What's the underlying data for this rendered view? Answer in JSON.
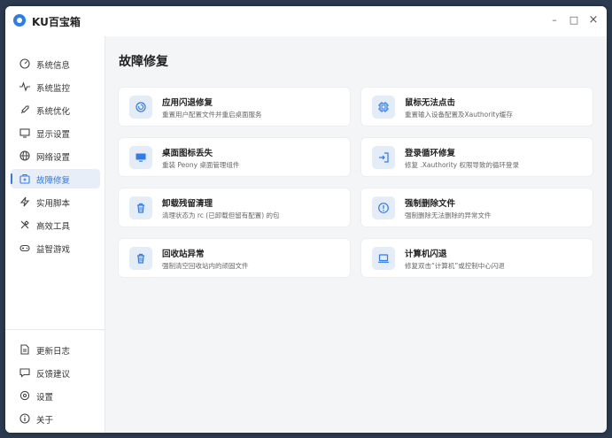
{
  "app": {
    "title": "KU百宝箱"
  },
  "window_controls": {
    "minimize": "–",
    "maximize": "□",
    "close": "×"
  },
  "sidebar": {
    "items": [
      {
        "label": "系统信息",
        "icon": "gauge-icon"
      },
      {
        "label": "系统监控",
        "icon": "pulse-icon"
      },
      {
        "label": "系统优化",
        "icon": "rocket-icon"
      },
      {
        "label": "显示设置",
        "icon": "monitor-icon"
      },
      {
        "label": "网络设置",
        "icon": "globe-icon"
      },
      {
        "label": "故障修复",
        "icon": "toolbox-icon",
        "active": true
      },
      {
        "label": "实用脚本",
        "icon": "lightning-icon"
      },
      {
        "label": "高效工具",
        "icon": "tools-icon"
      },
      {
        "label": "益智游戏",
        "icon": "gamepad-icon"
      }
    ],
    "bottom_items": [
      {
        "label": "更新日志",
        "icon": "document-icon"
      },
      {
        "label": "反馈建议",
        "icon": "chat-icon"
      },
      {
        "label": "设置",
        "icon": "gear-icon"
      },
      {
        "label": "关于",
        "icon": "info-icon"
      }
    ]
  },
  "main": {
    "title": "故障修复",
    "cards": [
      {
        "title": "应用闪退修复",
        "desc": "重置用户配置文件并重启桌面服务",
        "icon": "restart-icon"
      },
      {
        "title": "鼠标无法点击",
        "desc": "重置输入设备配置及Xauthority缓存",
        "icon": "chip-icon"
      },
      {
        "title": "桌面图标丢失",
        "desc": "重装 Peony 桌面管理组件",
        "icon": "desktop-icon"
      },
      {
        "title": "登录循环修复",
        "desc": "修复 .Xauthority 权限导致的循环登录",
        "icon": "login-icon"
      },
      {
        "title": "卸载残留清理",
        "desc": "清理状态为 rc (已卸载但留有配置) 的包",
        "icon": "trash-icon"
      },
      {
        "title": "强制删除文件",
        "desc": "强制删除无法删除的异常文件",
        "icon": "alert-icon"
      },
      {
        "title": "回收站异常",
        "desc": "强制清空回收站内的顽固文件",
        "icon": "trash-icon"
      },
      {
        "title": "计算机闪退",
        "desc": "修复双击“计算机”或控制中心闪退",
        "icon": "laptop-icon"
      }
    ]
  },
  "colors": {
    "accent": "#2f7be8",
    "card_icon_bg": "#e4ecf8"
  }
}
